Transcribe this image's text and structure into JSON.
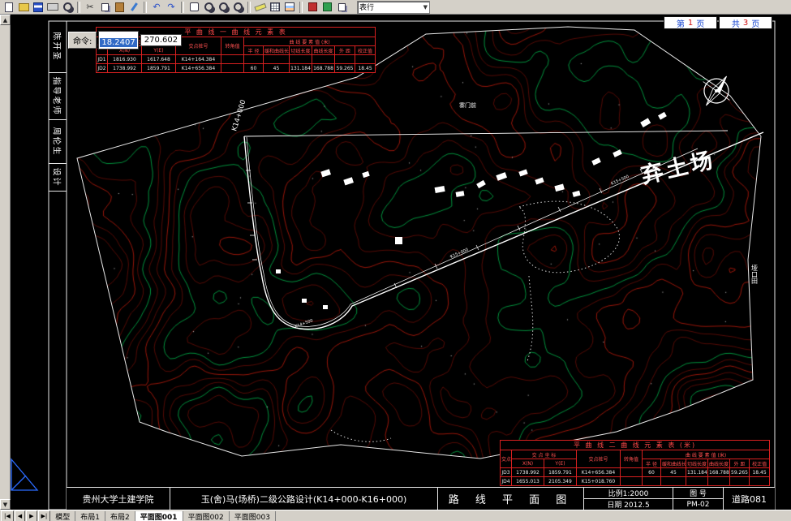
{
  "toolbar": {
    "combo_label": "表行",
    "icons": [
      "new",
      "open",
      "save",
      "print",
      "print-preview",
      "cut",
      "copy",
      "paste",
      "match-properties",
      "undo",
      "redo",
      "pan",
      "zoom-realtime",
      "zoom-window",
      "zoom-previous",
      "distance",
      "redraw",
      "layers",
      "layer-states",
      "color-red",
      "color-green",
      "grid",
      "properties"
    ]
  },
  "icons": {
    "up_arrow": "▲",
    "down_arrow": "▼",
    "combo_arrow": "▼",
    "undo": "↶",
    "redo": "↷",
    "cut": "✂"
  },
  "pager": {
    "p1_pre": "第",
    "p1_num": "1",
    "p1_suf": "页",
    "p2_pre": "共",
    "p2_num": "3",
    "p2_suf": "页"
  },
  "command": {
    "label": "命令:",
    "v1": "18.2407",
    "v2": "270.602"
  },
  "side": {
    "c0": "陈开圣",
    "c1": "指导老师",
    "c2": "周伦生",
    "c3": "设计"
  },
  "map": {
    "big_label": "弃土场",
    "km_label": "K14+000",
    "right_label": "垭口田",
    "village_label": "寨门前",
    "st": [
      "K14+500",
      "K15+000",
      "K15+500"
    ]
  },
  "t1": {
    "title": "平 曲 线 一    曲 线 元 素 表",
    "h": {
      "jd": "交点号",
      "coord": "交 点 坐 标",
      "x": "X(N)",
      "y": "Y(E)",
      "stn": "交点桩号",
      "ang": "转角值",
      "elem": "曲 线 要 素 值 (米)",
      "r": "半 径",
      "ls": "缓和曲线长度",
      "t": "切线长度",
      "l": "曲线长度",
      "e": "外 距",
      "j": "校正值"
    },
    "r": [
      [
        "JD1",
        "1816.930",
        "1617.648",
        "K14+164.384",
        "",
        "",
        "",
        "",
        "",
        "",
        ""
      ],
      [
        "JD2",
        "1738.992",
        "1859.791",
        "K14+656.384",
        "",
        "60",
        "45",
        "131.184",
        "168.788",
        "59.265",
        "18.45"
      ]
    ]
  },
  "t2": {
    "title": "平 曲 线 二    曲 线 元 素 表 (米)",
    "h": {
      "jd": "交点号",
      "coord": "交 点 坐 标",
      "x": "X(N)",
      "y": "Y(E)",
      "stn": "交点桩号",
      "ang": "转角值",
      "elem": "曲 线 要 素 值 (米)",
      "r": "半 径",
      "ls": "缓和曲线长度",
      "t": "切线长度",
      "l": "曲线长度",
      "e": "外 距",
      "j": "校正值"
    },
    "r": [
      [
        "JD3",
        "1738.992",
        "1859.791",
        "K14+656.384",
        "",
        "60",
        "45",
        "131.184",
        "168.788",
        "59.265",
        "18.45"
      ],
      [
        "JD4",
        "1655.013",
        "2105.349",
        "K15+018.760",
        "",
        "",
        "",
        "",
        "",
        "",
        ""
      ]
    ]
  },
  "tb": {
    "school": "贵州大学土建学院",
    "project": "玉(舍)马(场桥)二级公路设计(K14+000-K16+000)",
    "name": "路 线 平 面 图",
    "scale": "比例1:2000",
    "date": "日期 2012.5",
    "fig_label": "图 号",
    "fig_no": "PM-02",
    "code": "道路081"
  },
  "tab_nav": [
    "|◀",
    "◀",
    "▶",
    "▶|"
  ],
  "tabs": {
    "t0": "模型",
    "t1": "布局1",
    "t2": "布局2",
    "t3": "平面图001",
    "t4": "平面图002",
    "t5": "平面图003"
  },
  "canvas": {
    "colors": {
      "contour": "#9c150b",
      "contour_major": "#c01c0c",
      "index": "#00a244",
      "road": "#ffffff",
      "boundary": "#e8e8e8",
      "dotted": "#d8d8d8",
      "ucs": "#2b6bff"
    }
  }
}
